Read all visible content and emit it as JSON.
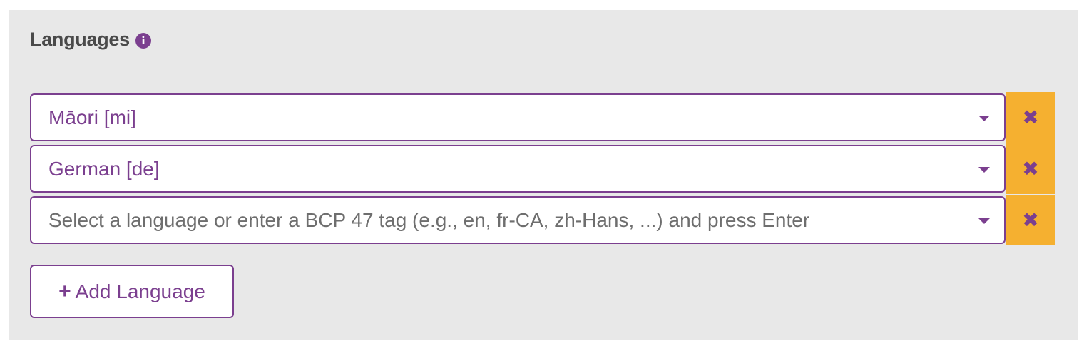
{
  "section": {
    "title": "Languages",
    "info_icon": "info-circle-icon"
  },
  "languages": [
    {
      "value": "Māori [mi]",
      "placeholder": ""
    },
    {
      "value": "German [de]",
      "placeholder": ""
    },
    {
      "value": "",
      "placeholder": "Select a language or enter a BCP 47 tag (e.g., en, fr-CA, zh-Hans, ...) and press Enter"
    }
  ],
  "remove_icon": "close-x-icon",
  "add_button": {
    "icon": "plus-icon",
    "label": "Add Language"
  },
  "colors": {
    "accent": "#7b3f8f",
    "remove_bg": "#f5b030",
    "panel_bg": "#e8e8e8"
  }
}
